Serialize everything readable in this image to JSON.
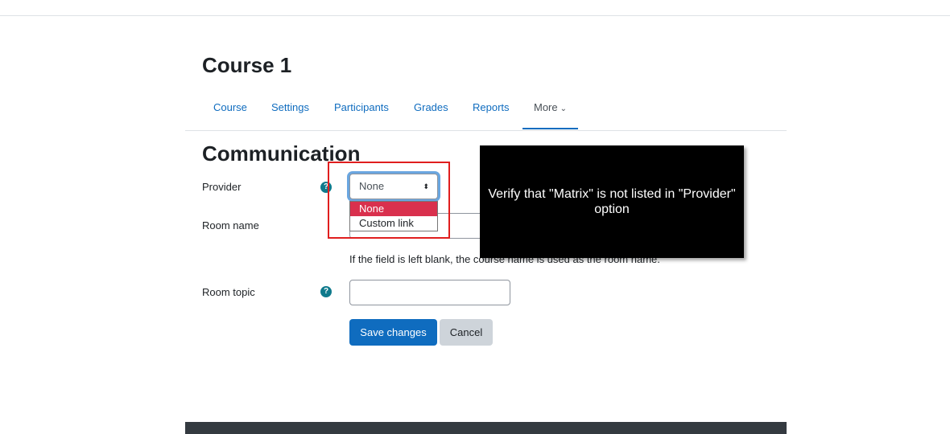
{
  "page": {
    "course_title": "Course 1",
    "section_title": "Communication"
  },
  "nav": {
    "items": [
      {
        "label": "Course"
      },
      {
        "label": "Settings"
      },
      {
        "label": "Participants"
      },
      {
        "label": "Grades"
      },
      {
        "label": "Reports"
      }
    ],
    "more_label": "More",
    "more_icon": "chevron-down-icon"
  },
  "form": {
    "provider": {
      "label": "Provider",
      "value": "None",
      "options": [
        "None",
        "Custom link"
      ],
      "selected": "None"
    },
    "room_name": {
      "label": "Room name",
      "value": "",
      "hint": "If the field is left blank, the course name is used as the room name."
    },
    "room_topic": {
      "label": "Room topic",
      "value": ""
    },
    "help_icon": "?",
    "save_label": "Save changes",
    "cancel_label": "Cancel"
  },
  "annotation": {
    "text": "Verify that \"Matrix\" is not listed in \"Provider\" option",
    "box_color": "#e01e1e"
  },
  "colors": {
    "link": "#0f6cbf",
    "primary_button": "#0f6cbf",
    "selected_option": "#d9304d",
    "help_icon": "#0f7a8c"
  }
}
